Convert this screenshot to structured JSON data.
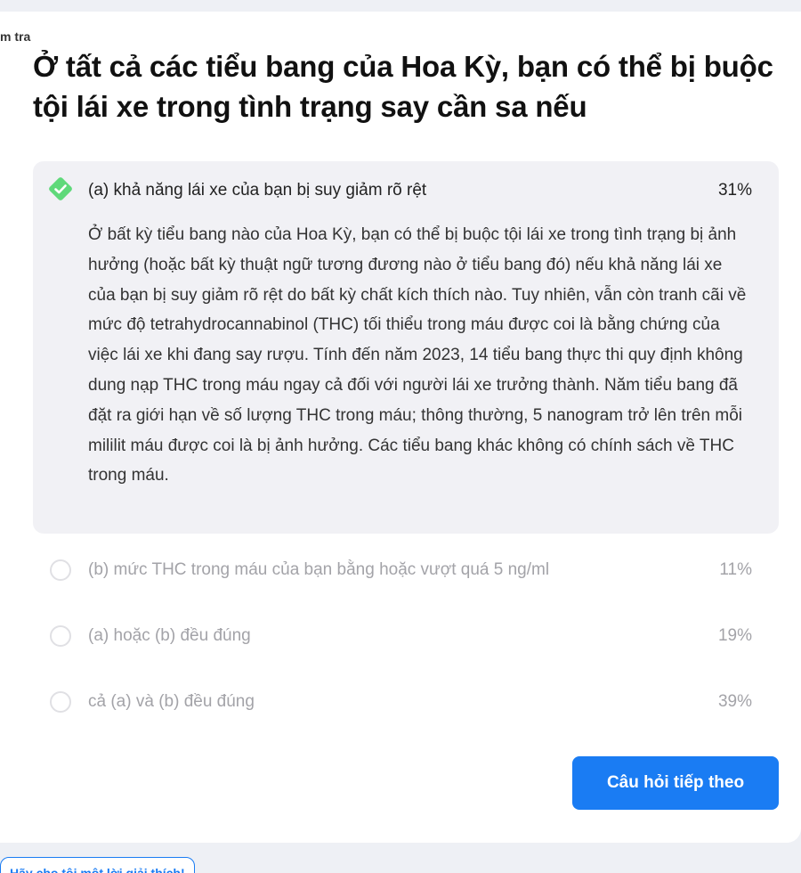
{
  "section_tag": "m tra",
  "question": {
    "title": "Ở tất cả các tiểu bang của Hoa Kỳ, bạn có thể bị buộc tội lái xe trong tình trạng say cần sa nếu"
  },
  "answers": [
    {
      "label": "(a) khả năng lái xe của bạn bị suy giảm rõ rệt",
      "percent": "31%",
      "selected": true,
      "correct": true,
      "explanation": "Ở bất kỳ tiểu bang nào của Hoa Kỳ, bạn có thể bị buộc tội lái xe trong tình trạng bị ảnh hưởng (hoặc bất kỳ thuật ngữ tương đương nào ở tiểu bang đó) nếu khả năng lái xe của bạn bị suy giảm rõ rệt do bất kỳ chất kích thích nào. Tuy nhiên, vẫn còn tranh cãi về mức độ tetrahydrocannabinol (THC) tối thiểu trong máu được coi là bằng chứng của việc lái xe khi đang say rượu. Tính đến năm 2023, 14 tiểu bang thực thi quy định không dung nạp THC trong máu ngay cả đối với người lái xe trưởng thành. Năm tiểu bang đã đặt ra giới hạn về số lượng THC trong máu; thông thường, 5 nanogram trở lên trên mỗi mililit máu được coi là bị ảnh hưởng. Các tiểu bang khác không có chính sách về THC trong máu."
    },
    {
      "label": "(b) mức THC trong máu của bạn bằng hoặc vượt quá 5 ng/ml",
      "percent": "11%",
      "selected": false
    },
    {
      "label": "(a) hoặc (b) đều đúng",
      "percent": "19%",
      "selected": false
    },
    {
      "label": "cả (a) và (b) đều đúng",
      "percent": "39%",
      "selected": false
    }
  ],
  "next_button_label": "Câu hỏi tiếp theo",
  "explain_link_label": "Hãy cho tôi một lời giải thích!",
  "colors": {
    "accent": "#1a7cf3",
    "correct": "#5fd97a",
    "selected_bg": "#f1f1f5",
    "page_bg": "#eef0f5"
  }
}
